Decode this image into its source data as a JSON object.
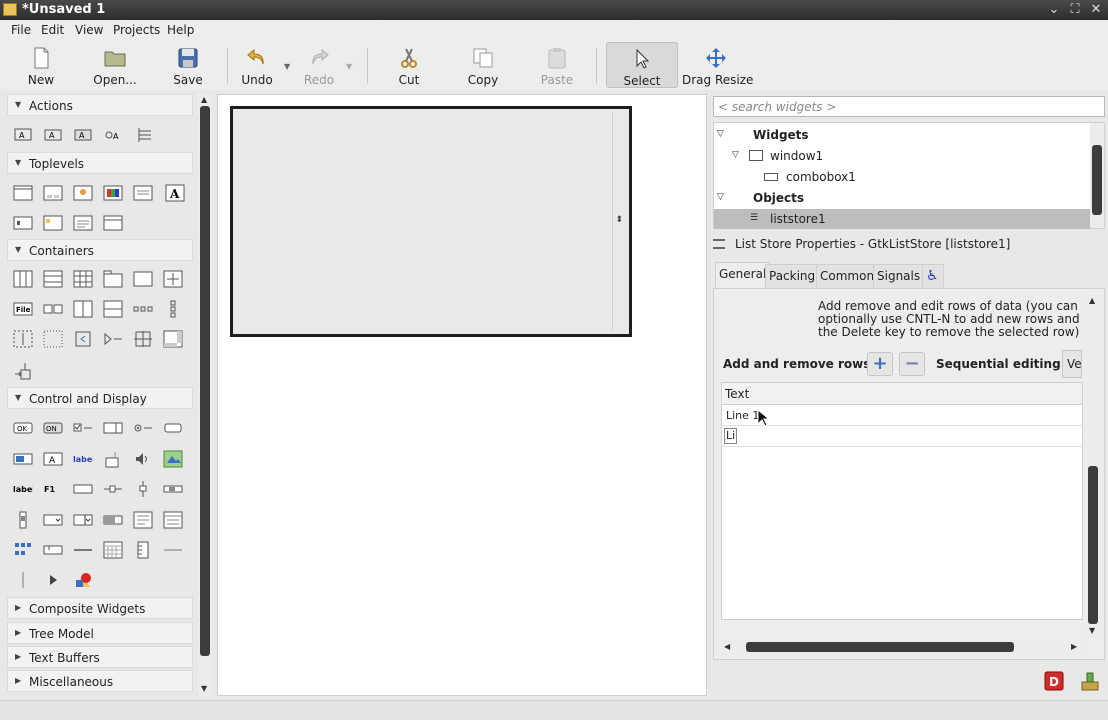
{
  "window": {
    "title": "*Unsaved 1"
  },
  "menu": [
    "File",
    "Edit",
    "View",
    "Projects",
    "Help"
  ],
  "toolbar": {
    "new": "New",
    "open": "Open...",
    "save": "Save",
    "undo": "Undo",
    "redo": "Redo",
    "cut": "Cut",
    "copy": "Copy",
    "paste": "Paste",
    "select": "Select",
    "drag_resize": "Drag Resize"
  },
  "palette": {
    "actions": "Actions",
    "toplevels": "Toplevels",
    "containers": "Containers",
    "control_display": "Control and Display",
    "composite": "Composite Widgets",
    "tree_model": "Tree Model",
    "text_buffers": "Text Buffers",
    "misc": "Miscellaneous",
    "icon_text": {
      "label": "label",
      "label2": "label",
      "file": "File",
      "ok": "OK",
      "on": "ON",
      "f1": "F1"
    }
  },
  "search": {
    "placeholder": "< search widgets >"
  },
  "tree": {
    "widgets": "Widgets",
    "window1": "window1",
    "combobox1": "combobox1",
    "objects": "Objects",
    "liststore1": "liststore1"
  },
  "properties": {
    "title": "List Store Properties - GtkListStore [liststore1]",
    "tabs": {
      "general": "General",
      "packing": "Packing",
      "common": "Common",
      "signals": "Signals"
    },
    "help": "Add remove and edit rows of data (you can optionally use CNTL-N to add new rows and the Delete key to remove the selected row)",
    "add_remove_label": "Add and remove rows:",
    "add_symbol": "+",
    "remove_symbol": "−",
    "sequential_label": "Sequential editing:",
    "sequential_value": "Ve",
    "column_header": "Text",
    "rows": [
      "Line 1",
      "Li"
    ]
  },
  "colors": {
    "accent_blue": "#3a6fc4",
    "selection": "#bdbdbd",
    "dark_scroll": "#3c3c3c"
  }
}
